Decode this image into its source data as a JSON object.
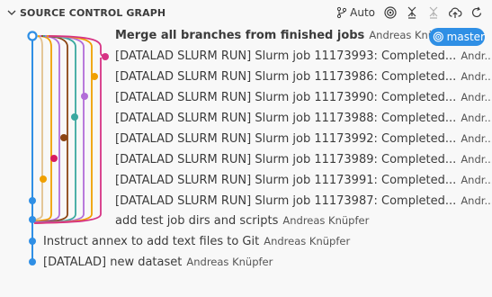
{
  "header": {
    "title": "SOURCE CONTROL GRAPH",
    "auto_label": "Auto"
  },
  "commits": [
    {
      "message": "Merge all branches from finished jobs",
      "author": "Andreas Knü..."
    },
    {
      "message": "[DATALAD SLURM RUN] Slurm job 11173993: Completed...",
      "author": "Andr..."
    },
    {
      "message": "[DATALAD SLURM RUN] Slurm job 11173986: Completed...",
      "author": "Andr..."
    },
    {
      "message": "[DATALAD SLURM RUN] Slurm job 11173990: Completed...",
      "author": "Andr..."
    },
    {
      "message": "[DATALAD SLURM RUN] Slurm job 11173988: Completed...",
      "author": "Andr..."
    },
    {
      "message": "[DATALAD SLURM RUN] Slurm job 11173992: Completed...",
      "author": "Andr..."
    },
    {
      "message": "[DATALAD SLURM RUN] Slurm job 11173989: Completed...",
      "author": "Andr..."
    },
    {
      "message": "[DATALAD SLURM RUN] Slurm job 11173991: Completed...",
      "author": "Andr..."
    },
    {
      "message": "[DATALAD SLURM RUN] Slurm job 11173987: Completed...",
      "author": "Andr..."
    },
    {
      "message": "add test job dirs and scripts",
      "author": "Andreas Knüpfer"
    },
    {
      "message": "Instruct annex to add text files to Git",
      "author": "Andreas Knüpfer"
    },
    {
      "message": "[DATALAD] new dataset",
      "author": "Andreas Knüpfer"
    }
  ],
  "branch_badge": {
    "label": "master"
  },
  "colors": {
    "accent": "#2f8fe5",
    "lane_colors": [
      "#2f8fe5",
      "#e2c08d",
      "#d63384",
      "#f0a000",
      "#b26cd8",
      "#3aa8a0",
      "#8b4513",
      "#d81b60",
      "#f0a000"
    ]
  }
}
